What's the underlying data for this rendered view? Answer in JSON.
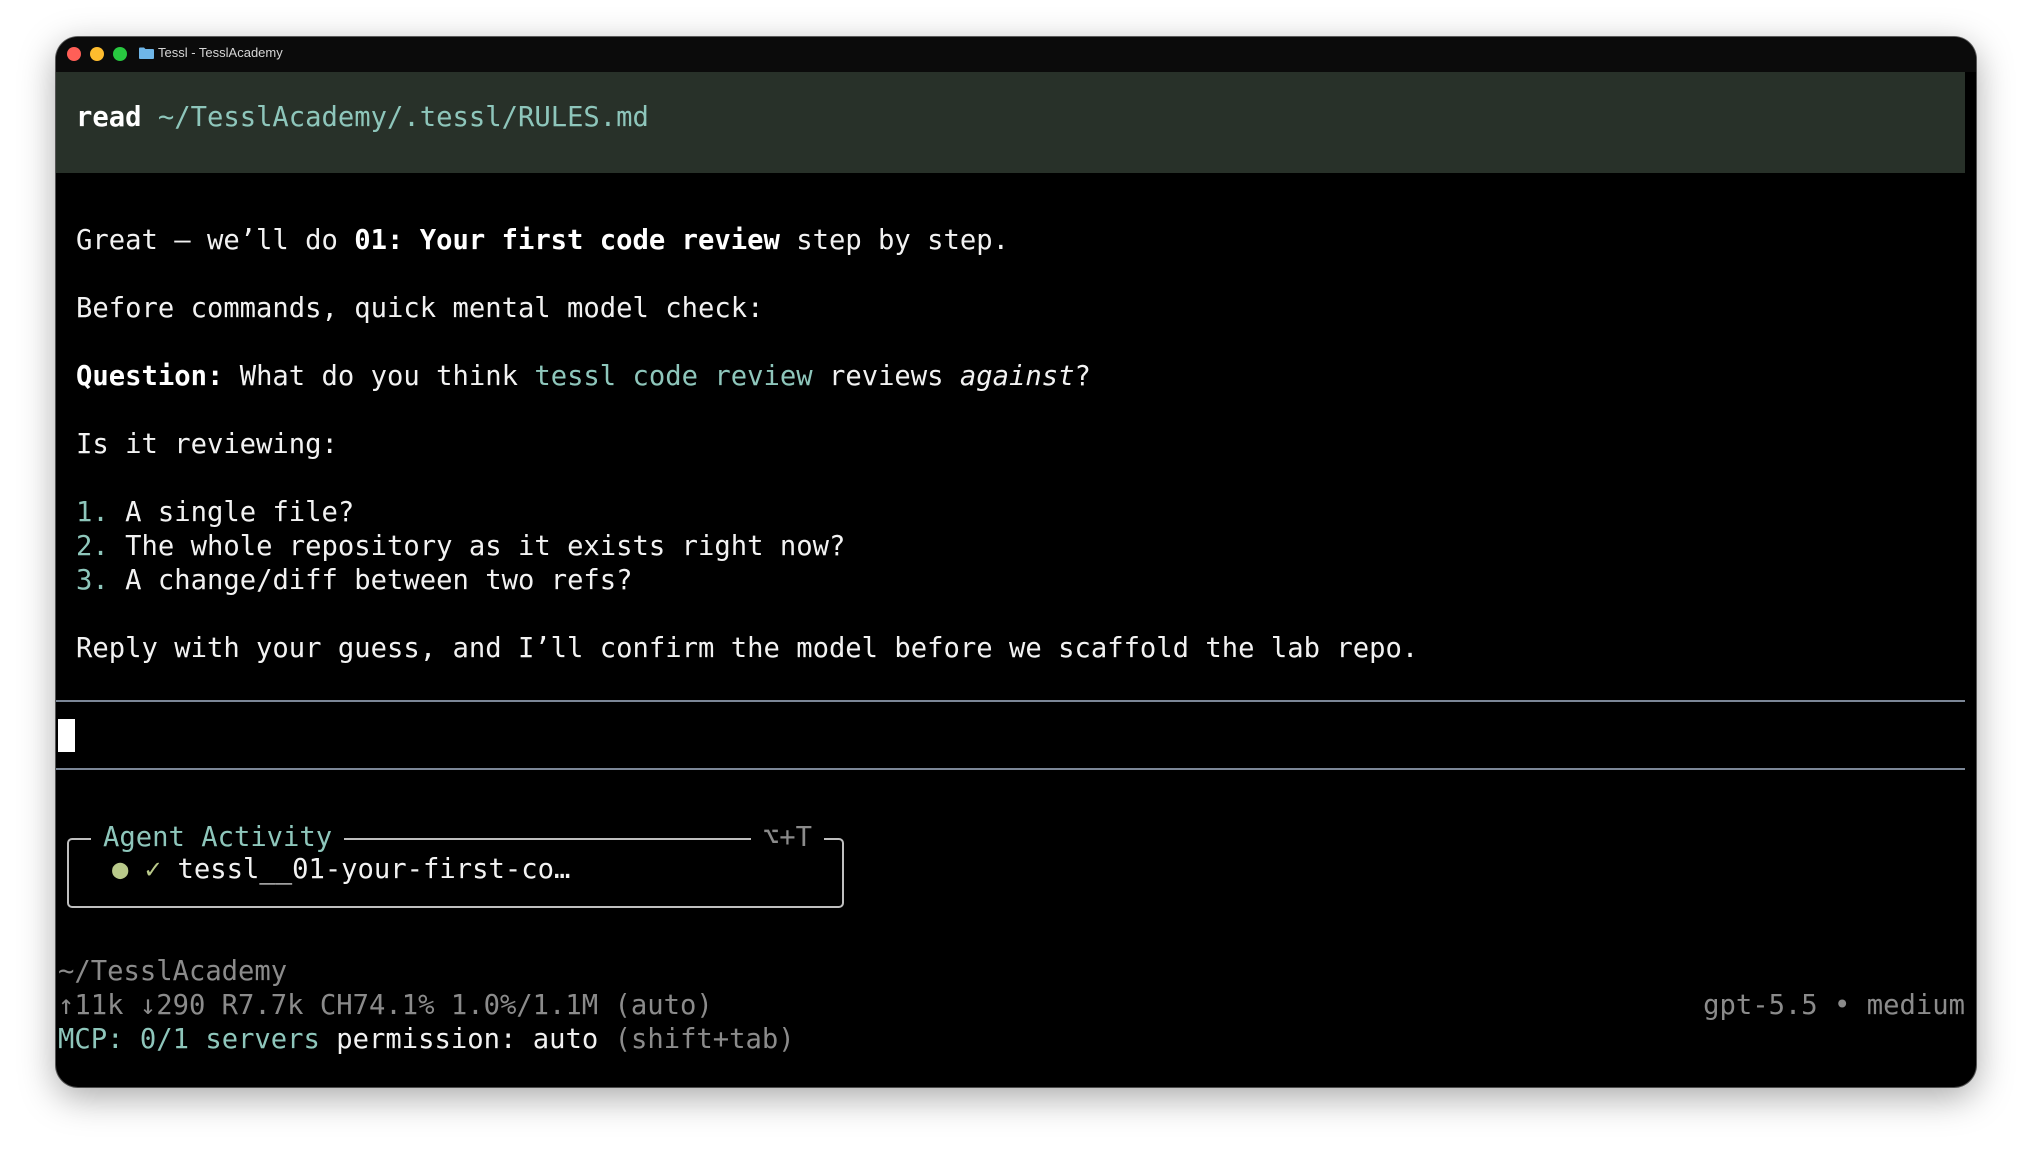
{
  "window": {
    "title": "Tessl - TesslAcademy",
    "traffic_colors": {
      "close": "#ff5f57",
      "minimize": "#febc2e",
      "maximize": "#28c840"
    }
  },
  "read_bar": {
    "command": "read",
    "path": "~/TesslAcademy/.tessl/RULES.md"
  },
  "message": {
    "line1": {
      "pre": "Great — we’ll do ",
      "bold": "01: Your first code review",
      "post": " step by step."
    },
    "line2": "Before commands, quick mental model check:",
    "line3": {
      "label": "Question:",
      "pre": " What do you think ",
      "code": "tessl code review",
      "mid": " reviews ",
      "italic": "against",
      "post": "?"
    },
    "line4": "Is it reviewing:",
    "options": [
      {
        "num": "1.",
        "text": "A single file?"
      },
      {
        "num": "2.",
        "text": "The whole repository as it exists right now?"
      },
      {
        "num": "3.",
        "text": "A change/diff between two refs?"
      }
    ],
    "line5": "Reply with your guess, and I’ll confirm the model before we scaffold the lab repo."
  },
  "agent_activity": {
    "title": "Agent Activity",
    "shortcut": "⌥+T",
    "items": [
      {
        "dot": "●",
        "check": "✓",
        "label": "tessl__01-your-first-co…"
      }
    ]
  },
  "status": {
    "cwd": "~/TesslAcademy",
    "tokens": "↑11k ↓290 R7.7k CH74.1% 1.0%/1.1M (auto)",
    "model": "gpt-5.5 • medium",
    "mcp_label": "MCP:",
    "mcp_value": "0/1 servers",
    "permission_label": "permission:",
    "permission_value": "auto",
    "permission_hint": "(shift+tab)"
  },
  "colors": {
    "accent_teal": "#8ec6bb",
    "read_bar_bg": "#283129",
    "divider": "#7c8797",
    "activity_green": "#b9c98a"
  }
}
